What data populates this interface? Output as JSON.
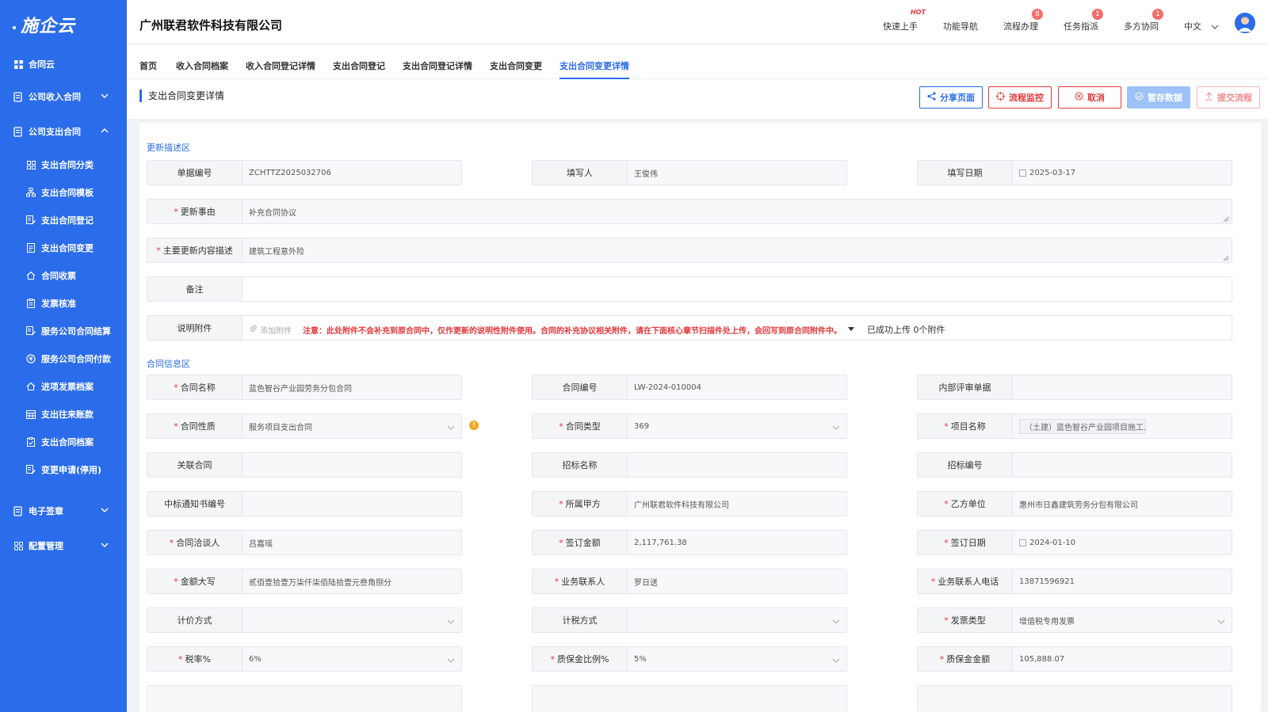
{
  "sidebar": {
    "logo": "施企云",
    "items": [
      {
        "label": "合同云",
        "icon": "grid-icon"
      },
      {
        "label": "公司收入合同",
        "icon": "document-icon",
        "chevron": "down"
      },
      {
        "label": "公司支出合同",
        "icon": "document-icon",
        "chevron": "up"
      },
      {
        "label": "电子签章",
        "icon": "document-icon",
        "chevron": "down"
      },
      {
        "label": "配置管理",
        "icon": "grid-icon",
        "chevron": "down"
      }
    ],
    "sub_items": [
      {
        "label": "支出合同分类",
        "icon": "grid-icon"
      },
      {
        "label": "支出合同模板",
        "icon": "tree-icon"
      },
      {
        "label": "支出合同登记",
        "icon": "edit-doc-icon"
      },
      {
        "label": "支出合同变更",
        "icon": "doc-icon"
      },
      {
        "label": "合同收票",
        "icon": "home-icon"
      },
      {
        "label": "发票核准",
        "icon": "clipboard-icon"
      },
      {
        "label": "服务公司合同结算",
        "icon": "edit-doc-icon"
      },
      {
        "label": "服务公司合同付款",
        "icon": "coin-icon"
      },
      {
        "label": "进项发票档案",
        "icon": "home-icon"
      },
      {
        "label": "支出往来账款",
        "icon": "calendar-icon"
      },
      {
        "label": "支出合同档案",
        "icon": "clipboard-icon"
      },
      {
        "label": "变更申请(停用)",
        "icon": "edit-doc-icon"
      }
    ]
  },
  "header": {
    "company": "广州联君软件科技有限公司",
    "tools": [
      {
        "label": "快速上手",
        "mark": "HOT"
      },
      {
        "label": "功能导航",
        "mark": ""
      },
      {
        "label": "流程办理",
        "mark": "8"
      },
      {
        "label": "任务指派",
        "mark": "1"
      },
      {
        "label": "多方协同",
        "mark": "1"
      }
    ],
    "language": "中文"
  },
  "tabs": [
    "首页",
    "收入合同档案",
    "收入合同登记详情",
    "支出合同登记",
    "支出合同登记详情",
    "支出合同变更",
    "支出合同变更详情"
  ],
  "active_tab": 6,
  "page": {
    "title": "支出合同变更详情",
    "buttons": {
      "share": "分享页面",
      "monitor": "流程监控",
      "cancel": "取消",
      "save": "暂存数据",
      "submit": "提交流程"
    }
  },
  "sections": {
    "update": "更新描述区",
    "contract": "合同信息区"
  },
  "update_fields": {
    "doc_no": {
      "label": "单据编号",
      "value": "ZCHTTZ2025032706"
    },
    "filler": {
      "label": "填写人",
      "value": "王俊伟"
    },
    "fill_date": {
      "label": "填写日期",
      "value": "2025-03-17"
    },
    "reason": {
      "label": "更新事由",
      "value": "补充合同协议"
    },
    "main_desc": {
      "label": "主要更新内容描述",
      "value": "建筑工程意外险"
    },
    "remark": {
      "label": "备注",
      "value": ""
    },
    "attachment": {
      "label": "说明附件",
      "add": "添加附件",
      "note": "注意：此处附件不会补充到原合同中，仅作更新的说明性附件使用。合同的补充协议相关附件，请在下面核心章节扫描件处上传，会回写到原合同附件中。",
      "uploaded": "已成功上传 0个附件"
    }
  },
  "contract_fields": {
    "name": {
      "label": "合同名称",
      "value": "蓝色智谷产业园劳务分包合同"
    },
    "code": {
      "label": "合同编号",
      "value": "LW-2024-010004"
    },
    "review_doc": {
      "label": "内部评审单据",
      "value": ""
    },
    "nature": {
      "label": "合同性质",
      "value": "服务项目支出合同"
    },
    "type": {
      "label": "合同类型",
      "value": "369"
    },
    "project": {
      "label": "项目名称",
      "value": "（土建）蓝色智谷产业园项目施工..."
    },
    "related": {
      "label": "关联合同",
      "value": ""
    },
    "bid_name": {
      "label": "招标名称",
      "value": ""
    },
    "bid_no": {
      "label": "招标编号",
      "value": ""
    },
    "notice_no": {
      "label": "中标通知书编号",
      "value": ""
    },
    "party_a": {
      "label": "所属甲方",
      "value": "广州联君软件科技有限公司"
    },
    "party_b": {
      "label": "乙方单位",
      "value": "惠州市日鑫建筑劳务分包有限公司"
    },
    "negotiator": {
      "label": "合同洽谈人",
      "value": "吕嘉瑶"
    },
    "amount": {
      "label": "签订金额",
      "value": "2,117,761.38"
    },
    "sign_date": {
      "label": "签订日期",
      "value": "2024-01-10"
    },
    "amount_cn": {
      "label": "金额大写",
      "value": "贰佰壹拾壹万柒仟柒佰陆拾壹元叁角捌分"
    },
    "biz_contact": {
      "label": "业务联系人",
      "value": "罗日送"
    },
    "biz_phone": {
      "label": "业务联系人电话",
      "value": "13871596921"
    },
    "pricing": {
      "label": "计价方式",
      "value": ""
    },
    "tax_method": {
      "label": "计税方式",
      "value": ""
    },
    "invoice_type": {
      "label": "发票类型",
      "value": "增值税专用发票"
    },
    "tax_rate": {
      "label": "税率%",
      "value": "6%"
    },
    "deposit_ratio": {
      "label": "质保金比例%",
      "value": "5%"
    },
    "deposit_amount": {
      "label": "质保金金额",
      "value": "105,888.07"
    }
  },
  "colors": {
    "accent": "#2b6cea",
    "danger": "#e4393c",
    "warning": "#f5a623"
  }
}
